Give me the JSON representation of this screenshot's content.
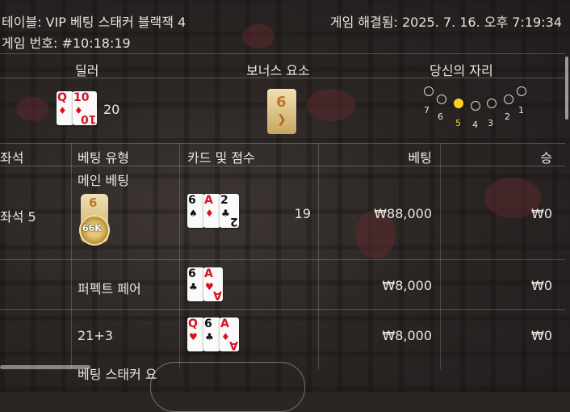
{
  "header": {
    "table_name": "테이블: VIP 베팅 스태커 블랙잭 4",
    "resolved": "게임 해결됨: 2025. 7. 16. 오후 7:19:34",
    "game_number": "게임 번호: #10:18:19"
  },
  "top_section": {
    "dealer_label": "딜러",
    "bonus_label": "보너스 요소",
    "your_seat_label": "당신의 자리",
    "dealer_score": "20",
    "dealer_cards": [
      {
        "rank": "Q",
        "suit": "♦",
        "color": "red"
      },
      {
        "rank": "10",
        "suit": "♦",
        "color": "red"
      }
    ],
    "bonus_value": "6",
    "seats": [
      {
        "num": "7",
        "active": false
      },
      {
        "num": "6",
        "active": false
      },
      {
        "num": "5",
        "active": true
      },
      {
        "num": "4",
        "active": false
      },
      {
        "num": "3",
        "active": false
      },
      {
        "num": "2",
        "active": false
      },
      {
        "num": "1",
        "active": false
      }
    ]
  },
  "table": {
    "columns": [
      "좌석",
      "베팅 유형",
      "카드 및 점수",
      "베팅",
      "승"
    ],
    "main_bet_label": "메인 베팅",
    "rows": [
      {
        "seat": "좌석 5",
        "bet_type": "",
        "score": "19",
        "bet": "₩88,000",
        "win": "₩0",
        "chip_top": "6",
        "chip_amount": "66K",
        "cards": [
          {
            "rank": "6",
            "suit": "♠",
            "color": "black"
          },
          {
            "rank": "A",
            "suit": "♦",
            "color": "red"
          },
          {
            "rank": "2",
            "suit": "♣",
            "color": "black"
          }
        ]
      },
      {
        "seat": "",
        "bet_type": "퍼펙트 페어",
        "score": "",
        "bet": "₩8,000",
        "win": "₩0",
        "cards": [
          {
            "rank": "6",
            "suit": "♣",
            "color": "black"
          },
          {
            "rank": "A",
            "suit": "♥",
            "color": "red"
          }
        ]
      },
      {
        "seat": "",
        "bet_type": "21+3",
        "score": "",
        "bet": "₩8,000",
        "win": "₩0",
        "cards": [
          {
            "rank": "Q",
            "suit": "♥",
            "color": "red"
          },
          {
            "rank": "6",
            "suit": "♣",
            "color": "black"
          },
          {
            "rank": "A",
            "suit": "♦",
            "color": "red"
          }
        ]
      }
    ],
    "partial_row_label": "베팅 스태커 요"
  }
}
